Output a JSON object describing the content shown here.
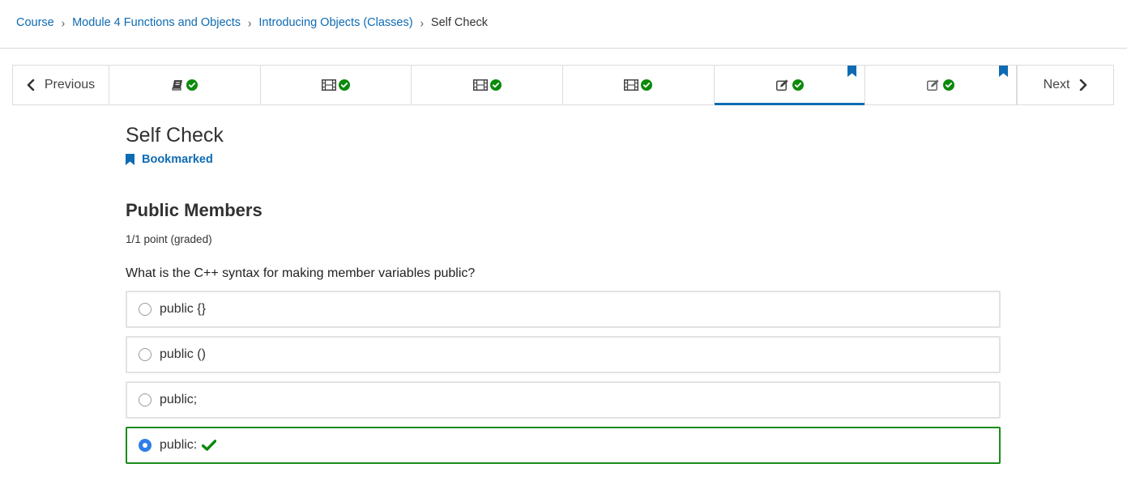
{
  "breadcrumb": {
    "items": [
      {
        "label": "Course"
      },
      {
        "label": "Module 4 Functions and Objects"
      },
      {
        "label": "Introducing Objects (Classes)"
      }
    ],
    "current": "Self Check",
    "separator": "›"
  },
  "sequence_nav": {
    "previous_label": "Previous",
    "next_label": "Next",
    "tabs": [
      {
        "icon": "book-icon",
        "completed": true,
        "bookmarked": false,
        "active": false
      },
      {
        "icon": "film-icon",
        "completed": true,
        "bookmarked": false,
        "active": false
      },
      {
        "icon": "film-icon",
        "completed": true,
        "bookmarked": false,
        "active": false
      },
      {
        "icon": "film-icon",
        "completed": true,
        "bookmarked": false,
        "active": false
      },
      {
        "icon": "edit-icon",
        "completed": true,
        "bookmarked": true,
        "active": true
      },
      {
        "icon": "edit-icon",
        "completed": true,
        "bookmarked": true,
        "active": false
      }
    ]
  },
  "unit": {
    "title": "Self Check",
    "bookmark_label": "Bookmarked"
  },
  "problem": {
    "title": "Public Members",
    "points": "1/1 point (graded)",
    "question": "What is the C++ syntax for making member variables public?",
    "choices": [
      {
        "label": "public {}",
        "selected": false,
        "correct": false
      },
      {
        "label": "public ()",
        "selected": false,
        "correct": false
      },
      {
        "label": "public;",
        "selected": false,
        "correct": false
      },
      {
        "label": "public:",
        "selected": true,
        "correct": true
      }
    ]
  },
  "colors": {
    "link": "#0e6bb3",
    "success": "#0b8a0b",
    "radio_selected": "#2f7ee8",
    "border": "#e2e2e2"
  }
}
